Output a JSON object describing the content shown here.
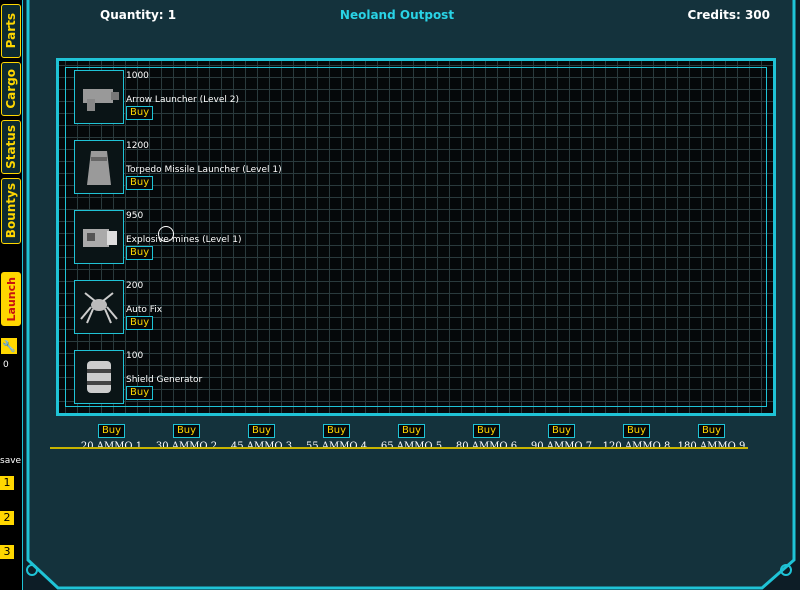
{
  "header": {
    "quantity": "Quantity: 1",
    "location": "Neoland Outpost",
    "credits": "Credits: 300"
  },
  "tabs": [
    "Parts",
    "Cargo",
    "Status",
    "Bountys"
  ],
  "launch_label": "Launch",
  "counter": "0",
  "save": {
    "label": "save",
    "slots": [
      "1",
      "2",
      "3"
    ]
  },
  "items": [
    {
      "price": "1000",
      "name": "Arrow Launcher (Level 2)",
      "buy": "Buy",
      "icon": "launcher-icon"
    },
    {
      "price": "1200",
      "name": "Torpedo Missile Launcher (Level 1)",
      "buy": "Buy",
      "icon": "torpedo-icon"
    },
    {
      "price": "950",
      "name": "Explosive-mines (Level 1)",
      "buy": "Buy",
      "icon": "mine-icon"
    },
    {
      "price": "200",
      "name": "Auto Fix",
      "buy": "Buy",
      "icon": "repair-bot-icon"
    },
    {
      "price": "100",
      "name": "Shield Generator",
      "buy": "Buy",
      "icon": "shield-generator-icon"
    }
  ],
  "ammo": [
    {
      "buy": "Buy",
      "label": "20 AMMO 1"
    },
    {
      "buy": "Buy",
      "label": "30 AMMO 2"
    },
    {
      "buy": "Buy",
      "label": "45 AMMO 3"
    },
    {
      "buy": "Buy",
      "label": "55 AMMO 4"
    },
    {
      "buy": "Buy",
      "label": "65 AMMO 5"
    },
    {
      "buy": "Buy",
      "label": "80 AMMO 6"
    },
    {
      "buy": "Buy",
      "label": "90 AMMO 7"
    },
    {
      "buy": "Buy",
      "label": "120 AMMO 8"
    },
    {
      "buy": "Buy",
      "label": "180 AMMO 9"
    }
  ],
  "colors": {
    "accent": "#1fc3d6",
    "gold": "#ffd700",
    "background": "#0d1d26"
  }
}
